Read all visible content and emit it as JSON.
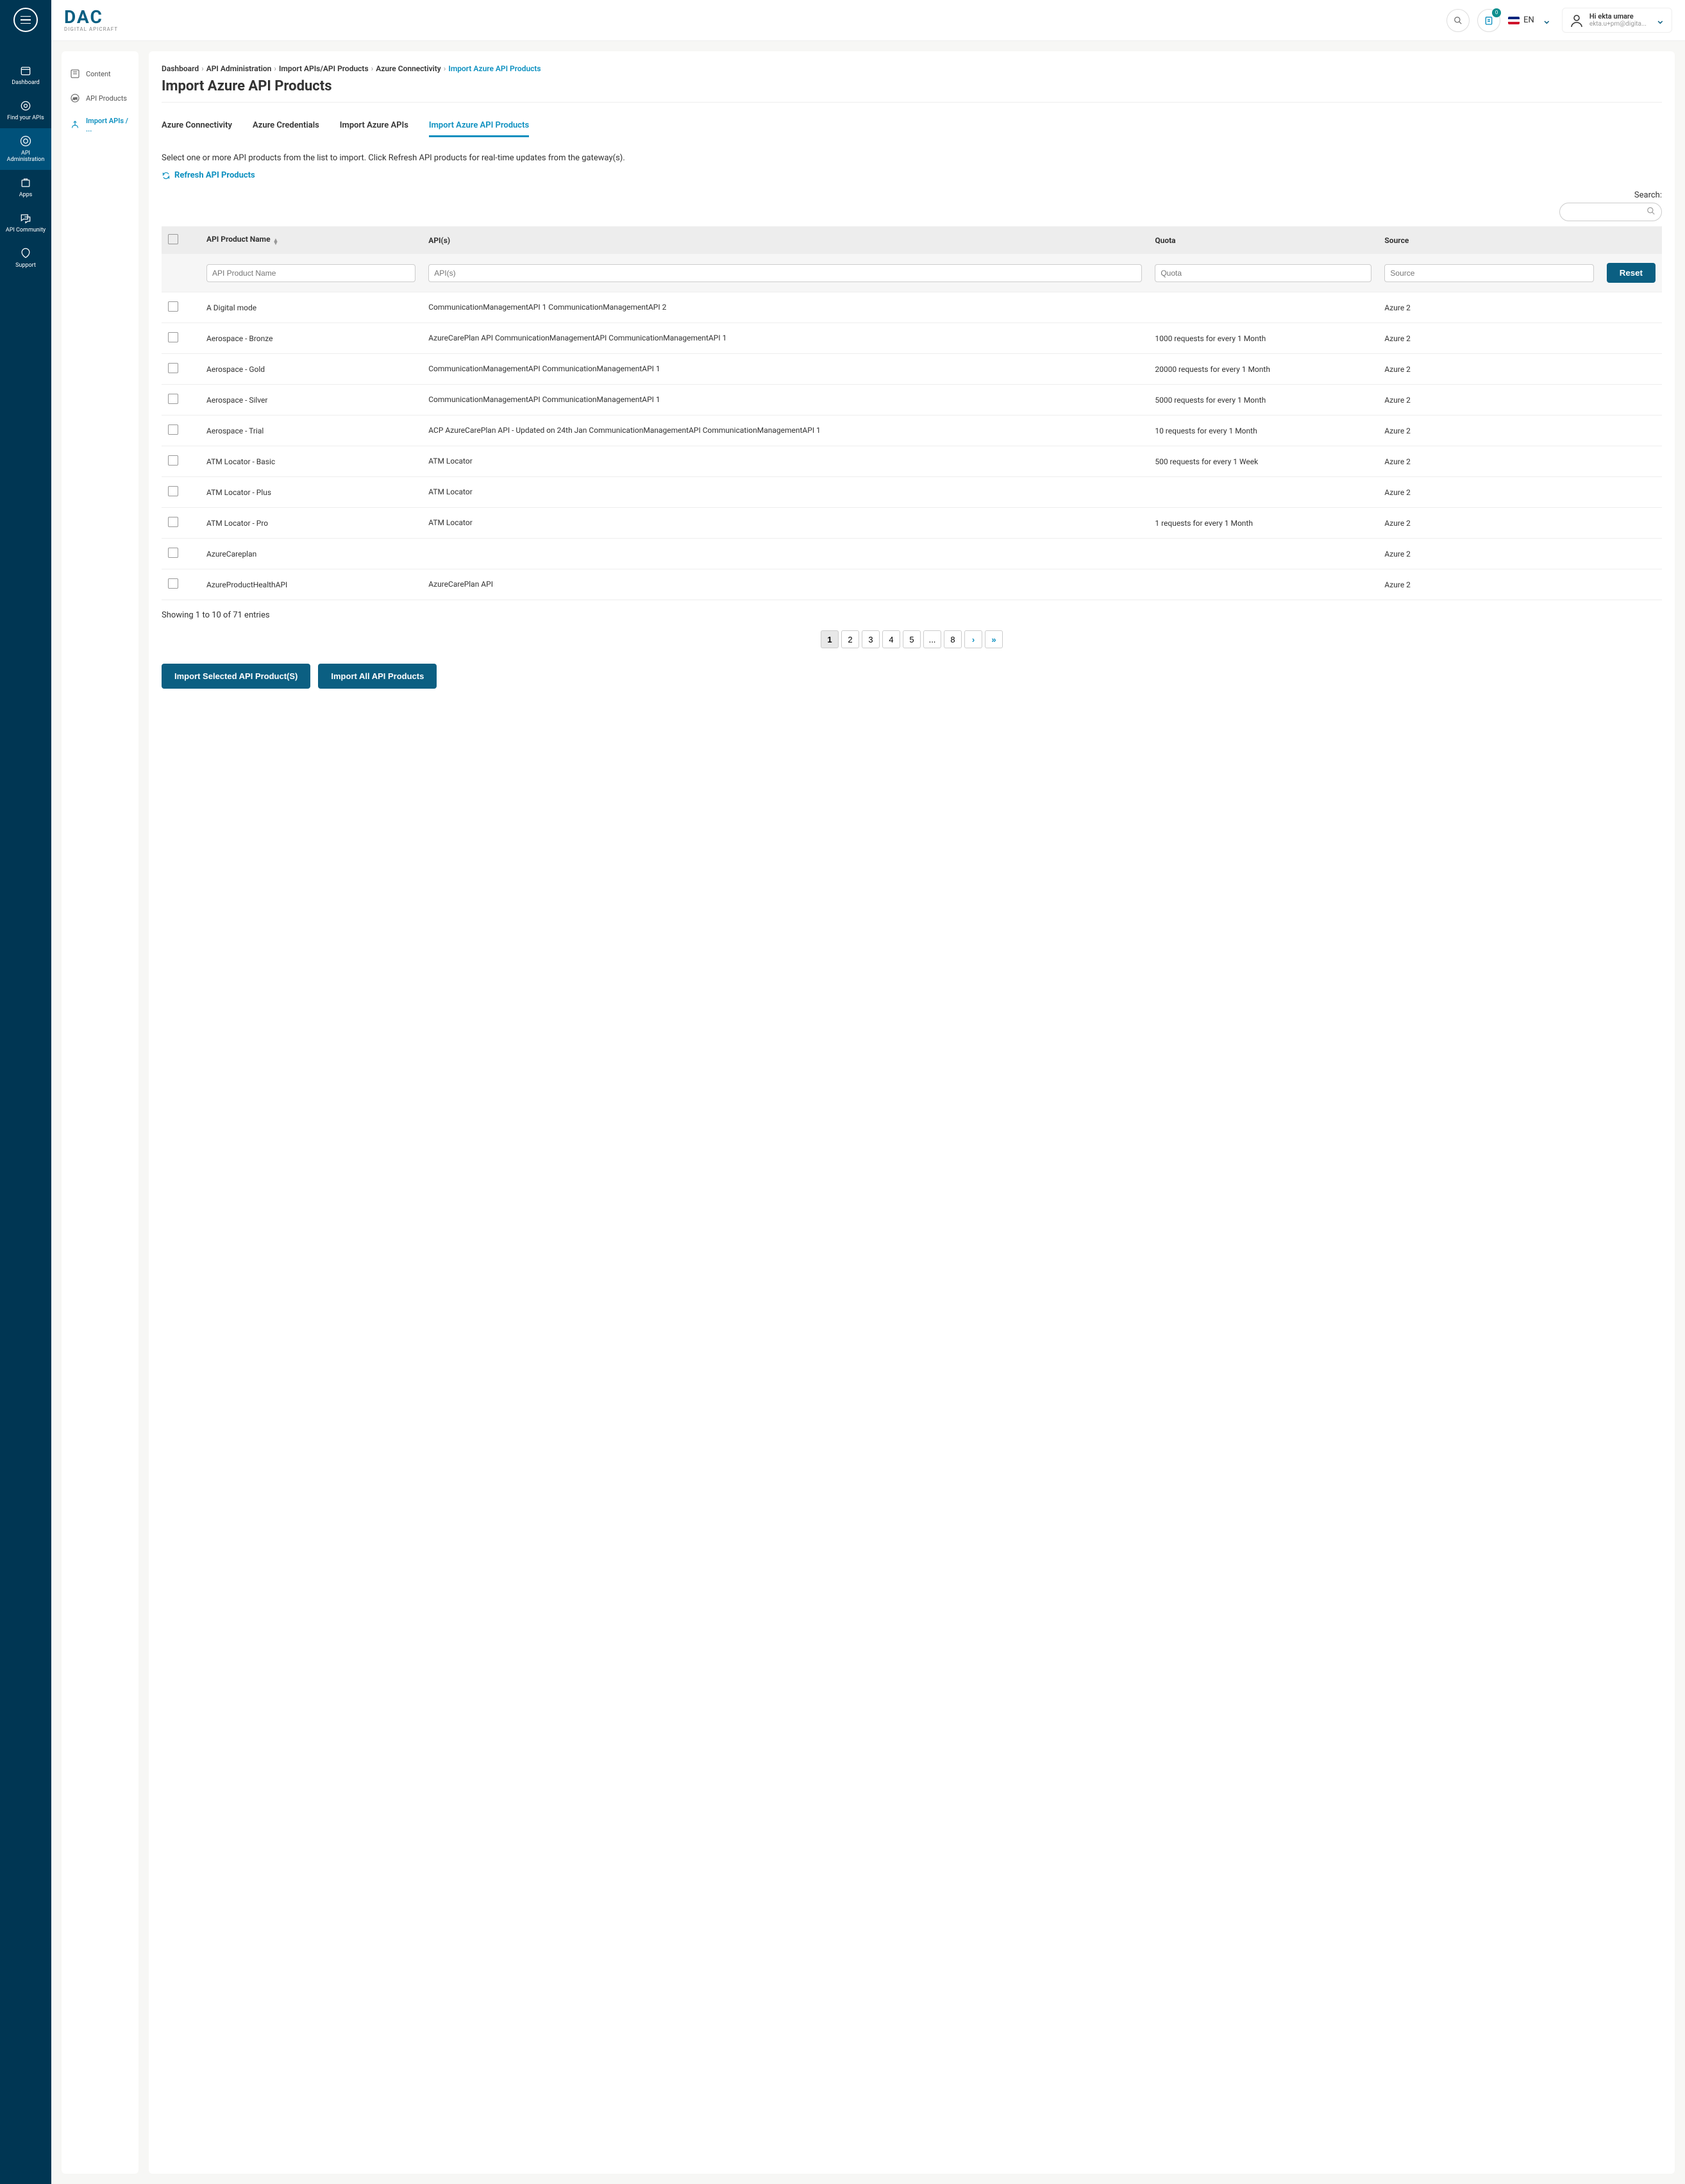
{
  "topbar": {
    "logo_text": "DAC",
    "logo_sub": "DIGITAL APICRAFT",
    "notification_count": "0",
    "lang_label": "EN",
    "user_greeting": "Hi ekta umare",
    "user_email": "ekta.u+pm@digita..."
  },
  "rail": {
    "items": [
      {
        "label": "Dashboard"
      },
      {
        "label": "Find your APIs"
      },
      {
        "label": "API Administration"
      },
      {
        "label": "Apps"
      },
      {
        "label": "API Community"
      },
      {
        "label": "Support"
      }
    ]
  },
  "sidebar": {
    "items": [
      {
        "label": "Content"
      },
      {
        "label": "API Products"
      },
      {
        "label": "Import APIs / ..."
      }
    ]
  },
  "breadcrumb": {
    "items": [
      "Dashboard",
      "API Administration",
      "Import APIs/API Products",
      "Azure Connectivity",
      "Import Azure API Products"
    ]
  },
  "page": {
    "title": "Import Azure API Products",
    "instruction": "Select one or more API products from the list to import. Click Refresh API products for real-time updates from the gateway(s).",
    "refresh_label": "Refresh API Products",
    "search_label": "Search:",
    "footer_text": "Showing 1 to 10 of 71 entries"
  },
  "tabs": {
    "items": [
      "Azure Connectivity",
      "Azure Credentials",
      "Import Azure APIs",
      "Import Azure API Products"
    ]
  },
  "table": {
    "headers": {
      "name": "API Product Name",
      "apis": "API(s)",
      "quota": "Quota",
      "source": "Source"
    },
    "filters": {
      "name_ph": "API Product Name",
      "apis_ph": "API(s)",
      "quota_ph": "Quota",
      "source_ph": "Source",
      "reset_label": "Reset"
    },
    "rows": [
      {
        "name": "A Digital mode",
        "apis": "CommunicationManagementAPI 1 CommunicationManagementAPI 2",
        "quota": "",
        "source": "Azure 2"
      },
      {
        "name": "Aerospace - Bronze",
        "apis": "AzureCarePlan API CommunicationManagementAPI CommunicationManagementAPI 1",
        "quota": "1000 requests for every 1 Month",
        "source": "Azure 2"
      },
      {
        "name": "Aerospace - Gold",
        "apis": "CommunicationManagementAPI CommunicationManagementAPI 1",
        "quota": "20000 requests for every 1 Month",
        "source": "Azure 2"
      },
      {
        "name": "Aerospace - Silver",
        "apis": "CommunicationManagementAPI CommunicationManagementAPI 1",
        "quota": "5000 requests for every 1 Month",
        "source": "Azure 2"
      },
      {
        "name": "Aerospace - Trial",
        "apis": "ACP AzureCarePlan API - Updated on 24th Jan CommunicationManagementAPI CommunicationManagementAPI 1",
        "quota": "10 requests for every 1 Month",
        "source": "Azure 2"
      },
      {
        "name": "ATM Locator - Basic",
        "apis": "ATM Locator",
        "quota": "500 requests for every 1 Week",
        "source": "Azure 2"
      },
      {
        "name": "ATM Locator - Plus",
        "apis": "ATM Locator",
        "quota": "",
        "source": "Azure 2"
      },
      {
        "name": "ATM Locator - Pro",
        "apis": "ATM Locator",
        "quota": "1 requests for every 1 Month",
        "source": "Azure 2"
      },
      {
        "name": "AzureCareplan",
        "apis": "",
        "quota": "",
        "source": "Azure 2"
      },
      {
        "name": "AzureProductHealthAPI",
        "apis": "AzureCarePlan API",
        "quota": "",
        "source": "Azure 2"
      }
    ]
  },
  "pagination": {
    "pages": [
      "1",
      "2",
      "3",
      "4",
      "5",
      "...",
      "8"
    ]
  },
  "actions": {
    "import_selected": "Import Selected API Product(S)",
    "import_all": "Import All API Products"
  }
}
